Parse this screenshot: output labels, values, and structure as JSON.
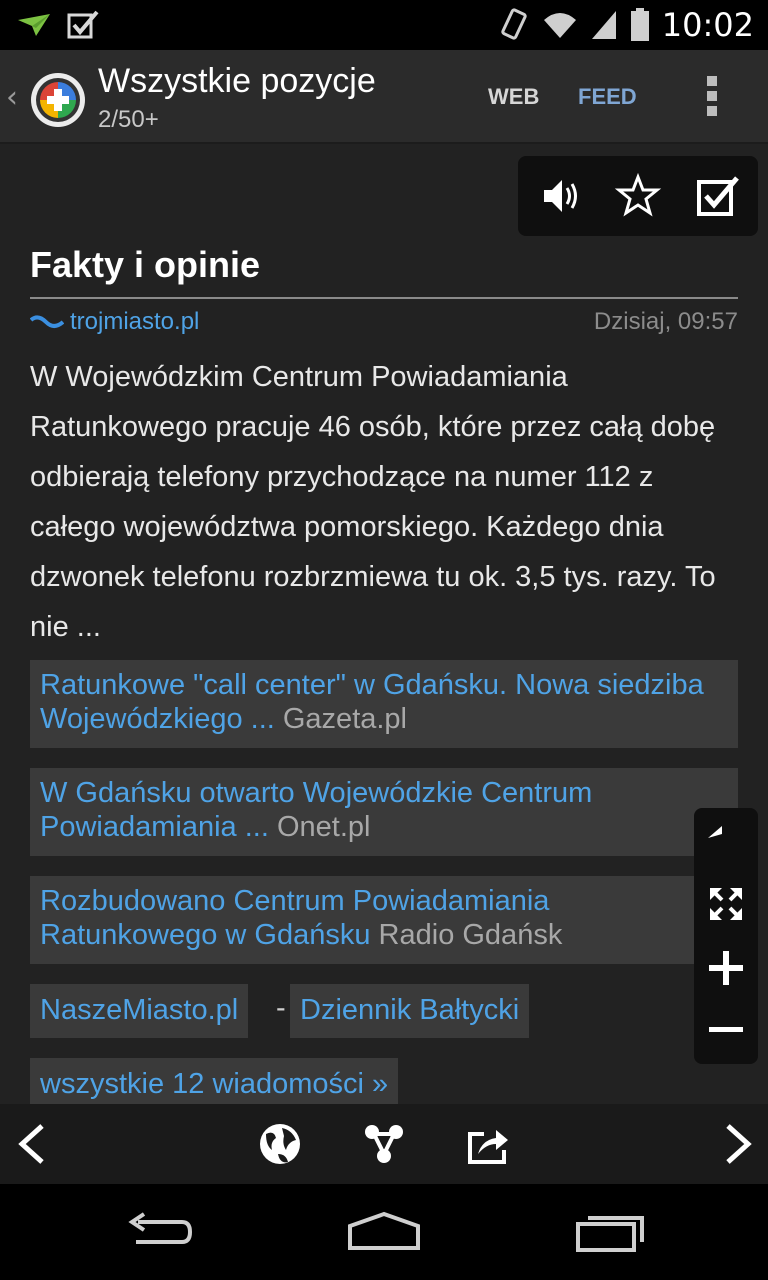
{
  "status_bar": {
    "time": "10:02",
    "left_icons": [
      "send-notification-icon",
      "checkbox-notification-icon"
    ],
    "right_icons": [
      "vibrate-icon",
      "wifi-icon",
      "signal-icon",
      "battery-icon"
    ]
  },
  "app_bar": {
    "title": "Wszystkie pozycje",
    "subtitle": "2/50+",
    "tab_web": "WEB",
    "tab_feed": "FEED",
    "accent_color": "#7fa6d4"
  },
  "actions": {
    "icons": [
      "speaker-icon",
      "star-icon",
      "checkbox-icon"
    ]
  },
  "article": {
    "title": "Fakty i opinie",
    "source": "trojmiasto.pl",
    "date": "Dzisiaj, 09:57",
    "body": "W Wojewódzkim Centrum Powiadamiania Ratunkowego pracuje 46 osób, które przez całą dobę odbierają telefony przychodzące na numer 112 z całego województwa pomorskiego. Każdego dnia dzwonek telefonu rozbrzmiewa tu ok. 3,5 tys. razy. To nie ..."
  },
  "related": [
    {
      "title": "Ratunkowe \"call center\" w Gdańsku. Nowa siedziba Wojewódzkiego ...",
      "source": "Gazeta.pl"
    },
    {
      "title": "W Gdańsku otwarto Wojewódzkie Centrum Powiadamiania ...",
      "source": "Onet.pl"
    },
    {
      "title": "Rozbudowano Centrum Powiadamiania Ratunkowego w Gdańsku",
      "source": "Radio Gdańsk"
    }
  ],
  "extra_sources": {
    "first": "NaszeMiasto.pl",
    "separator": "-",
    "second": "Dziennik Bałtycki"
  },
  "all_news": "wszystkie 12 wiadomości »",
  "zoom_panel": {
    "icons": [
      "reply-icon",
      "fullscreen-icon",
      "plus-icon",
      "minus-icon"
    ]
  },
  "bottom_toolbar": {
    "icons": [
      "previous-icon",
      "globe-icon",
      "share-graph-icon",
      "export-icon",
      "next-icon"
    ]
  },
  "nav_bar": {
    "icons": [
      "back-icon",
      "home-icon",
      "recents-icon"
    ]
  },
  "colors": {
    "link": "#4fa3e6",
    "background": "#222222",
    "card": "#3a3a3a"
  }
}
